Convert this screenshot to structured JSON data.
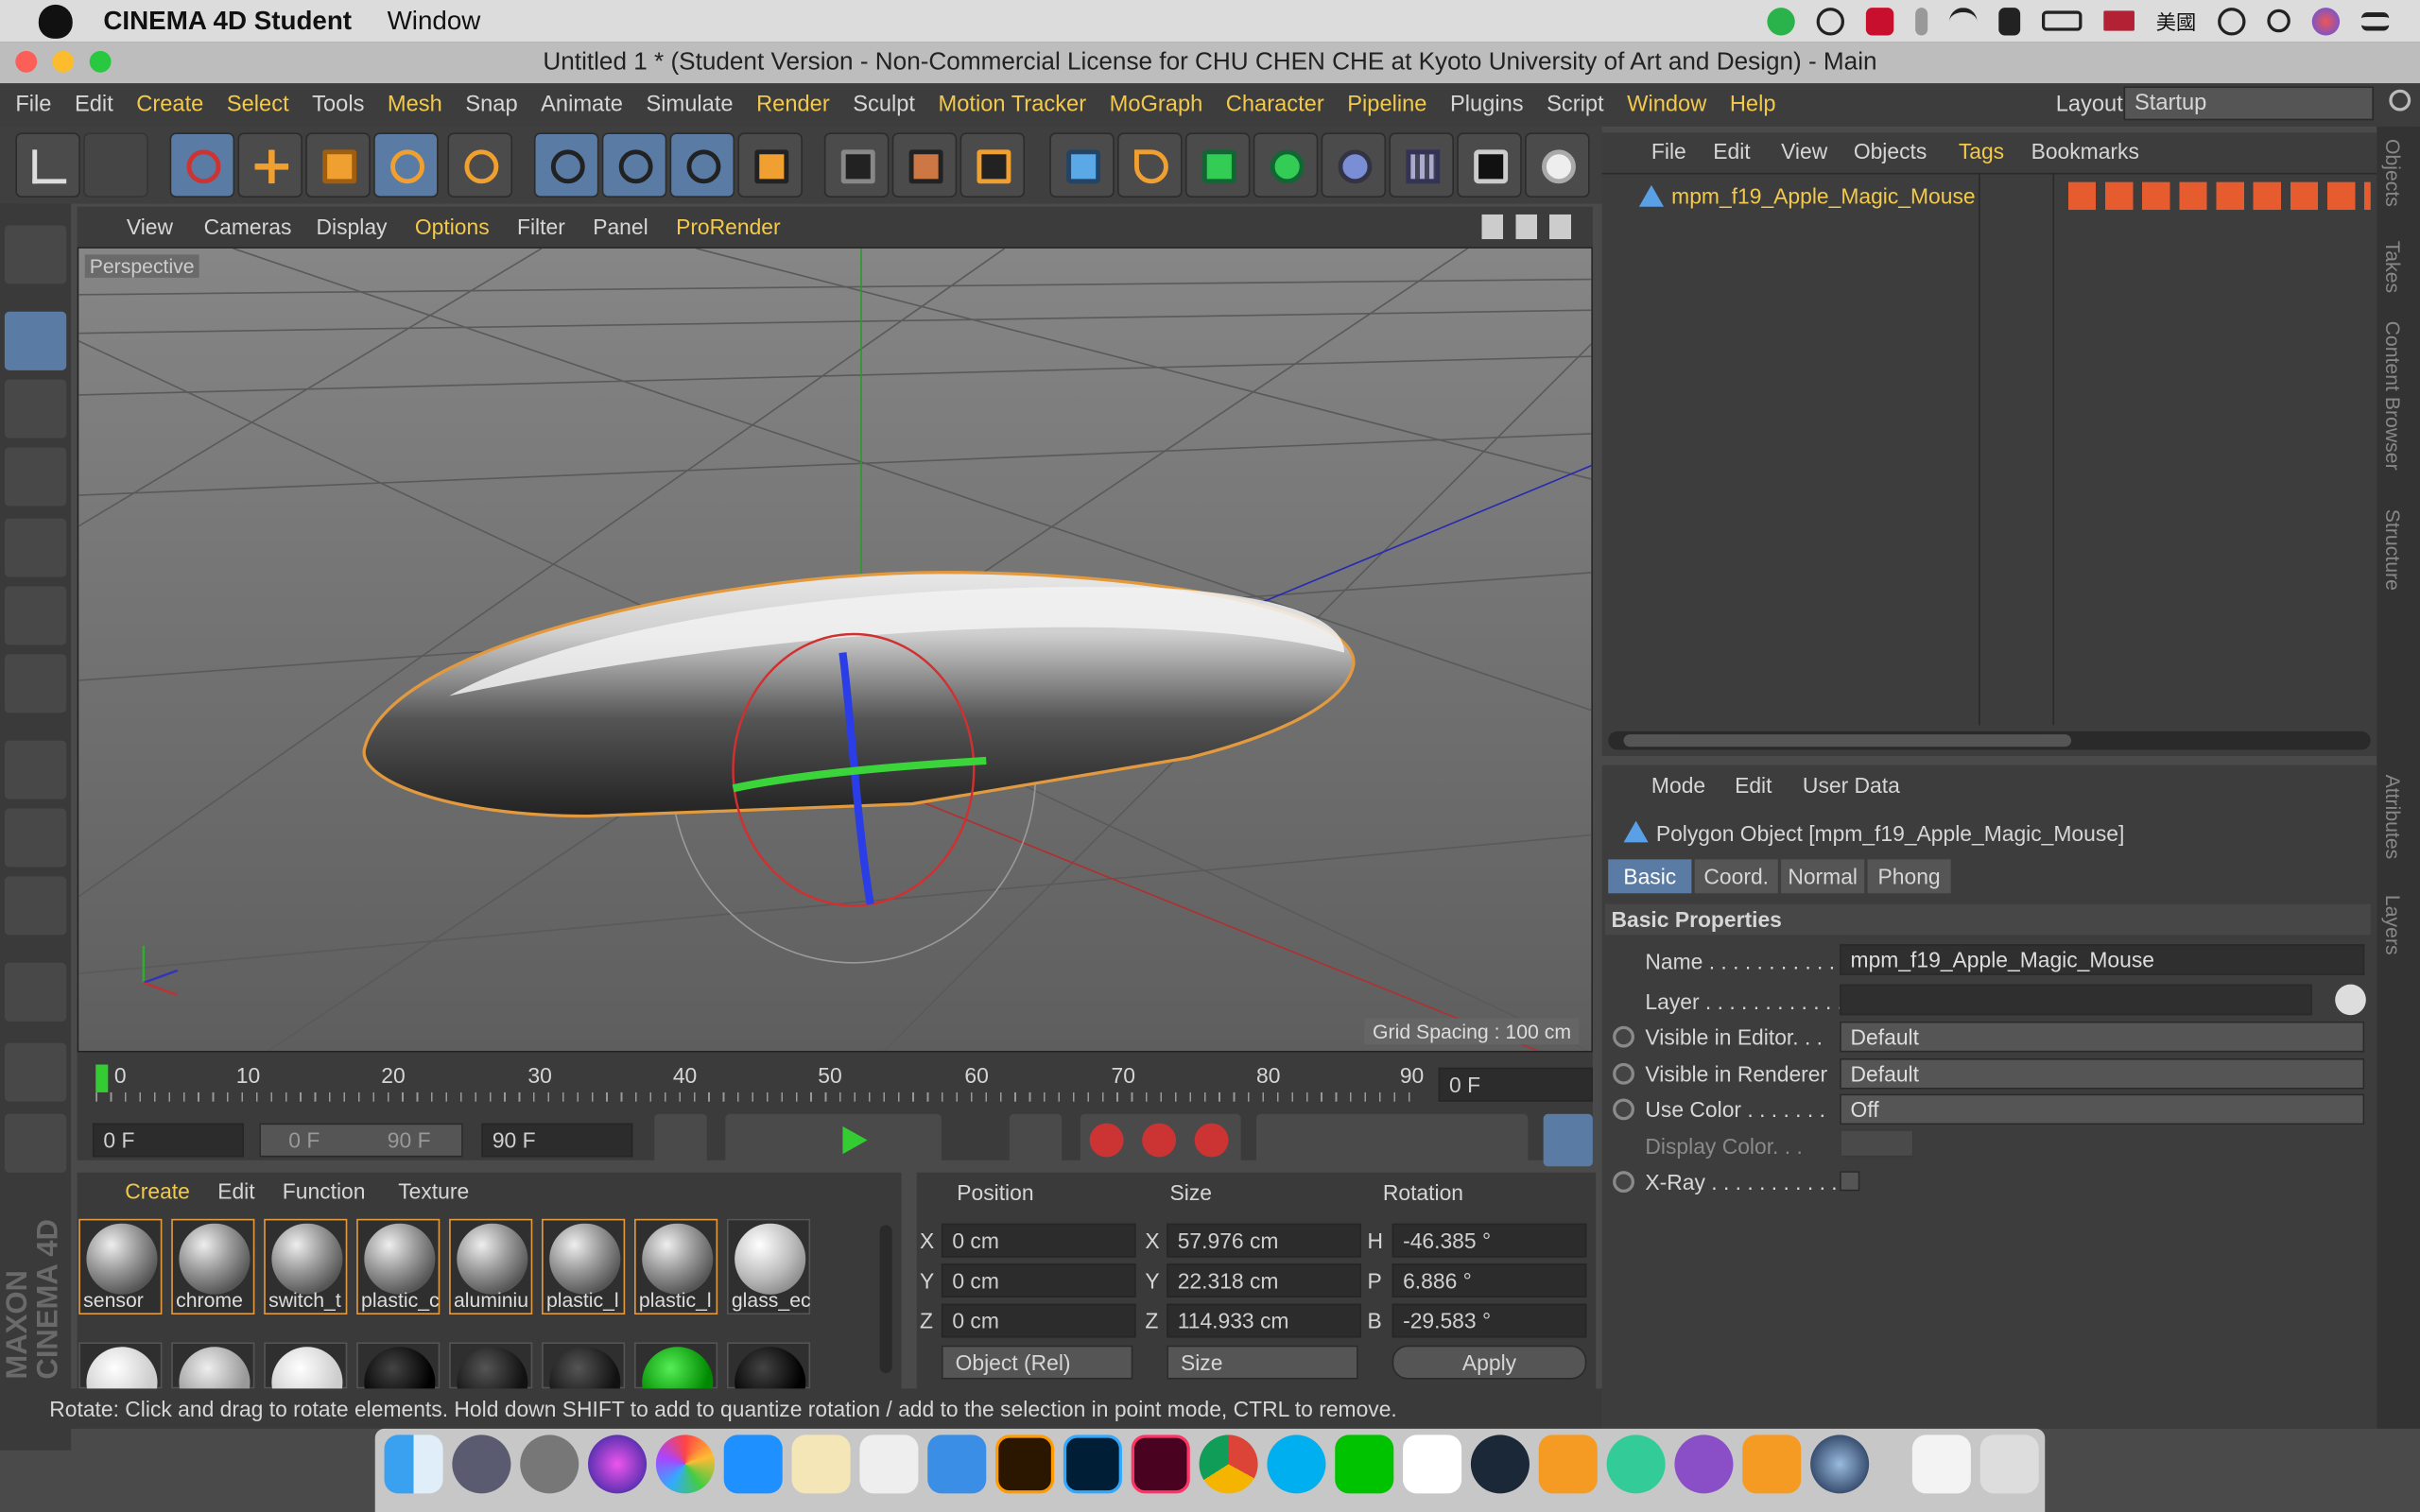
{
  "macbar": {
    "app": "CINEMA 4D Student",
    "menu": "Window",
    "lang": "美國"
  },
  "title": "Untitled 1 * (Student Version - Non-Commercial License for CHU CHEN CHE at Kyoto University of Art and Design) - Main",
  "menu": {
    "items": [
      "File",
      "Edit",
      "Create",
      "Select",
      "Tools",
      "Mesh",
      "Snap",
      "Animate",
      "Simulate",
      "Render",
      "Sculpt",
      "Motion Tracker",
      "MoGraph",
      "Character",
      "Pipeline",
      "Plugins",
      "Script",
      "Window",
      "Help"
    ],
    "highlighted": [
      "Create",
      "Select",
      "Mesh",
      "Render",
      "Motion Tracker",
      "MoGraph",
      "Character",
      "Pipeline",
      "Window",
      "Help"
    ],
    "layout_label": "Layout:",
    "layout_value": "Startup"
  },
  "viewport": {
    "menu": [
      "View",
      "Cameras",
      "Display",
      "Options",
      "Filter",
      "Panel",
      "ProRender"
    ],
    "label": "Perspective",
    "grid": "Grid Spacing : 100 cm"
  },
  "timeline": {
    "ticks": [
      "0",
      "10",
      "20",
      "30",
      "40",
      "50",
      "60",
      "70",
      "80",
      "90"
    ],
    "current": "0 F",
    "start": "0 F",
    "range_start": "0 F",
    "range_end": "90 F",
    "end": "90 F"
  },
  "materials": {
    "menu": [
      "Create",
      "Edit",
      "Function",
      "Texture"
    ],
    "items": [
      "sensor",
      "chrome",
      "switch_t",
      "plastic_c",
      "aluminiu",
      "plastic_l",
      "plastic_l",
      "glass_ec"
    ]
  },
  "coords": {
    "headers": [
      "Position",
      "Size",
      "Rotation"
    ],
    "rows": [
      {
        "axis": "X",
        "pos": "0 cm",
        "saxis": "X",
        "size": "57.976 cm",
        "raxis": "H",
        "rot": "-46.385 °"
      },
      {
        "axis": "Y",
        "pos": "0 cm",
        "saxis": "Y",
        "size": "22.318 cm",
        "raxis": "P",
        "rot": "6.886 °"
      },
      {
        "axis": "Z",
        "pos": "0 cm",
        "saxis": "Z",
        "size": "114.933 cm",
        "raxis": "B",
        "rot": "-29.583 °"
      }
    ],
    "mode": "Object (Rel)",
    "size_mode": "Size",
    "apply": "Apply"
  },
  "objects": {
    "menu": [
      "File",
      "Edit",
      "View",
      "Objects",
      "Tags",
      "Bookmarks"
    ],
    "item": "mpm_f19_Apple_Magic_Mouse"
  },
  "attributes": {
    "menu": [
      "Mode",
      "Edit",
      "User Data"
    ],
    "object": "Polygon Object [mpm_f19_Apple_Magic_Mouse]",
    "tabs": [
      "Basic",
      "Coord.",
      "Normal",
      "Phong"
    ],
    "section": "Basic Properties",
    "name_label": "Name . . . . . . . . . . . .",
    "name_value": "mpm_f19_Apple_Magic_Mouse",
    "layer_label": "Layer . . . . . . . . . . . .",
    "vis_editor_label": "Visible in Editor. . .",
    "vis_editor": "Default",
    "vis_render_label": "Visible in Renderer",
    "vis_render": "Default",
    "use_color_label": "Use Color . . . . . . .",
    "use_color": "Off",
    "display_color_label": "Display Color. . .",
    "xray_label": "X-Ray . . . . . . . . . . ."
  },
  "right_tabs": [
    "Objects",
    "Takes",
    "Content Browser",
    "Structure",
    "Attributes",
    "Layers"
  ],
  "status": "Rotate: Click and drag to rotate elements. Hold down SHIFT to add to quantize rotation / add to the selection in point mode, CTRL to remove.",
  "brand": "MAXON CINEMA 4D",
  "colors": {
    "accent": "#f2c94c",
    "selected": "#5a7ca4",
    "dock": "#c7c7c7"
  }
}
